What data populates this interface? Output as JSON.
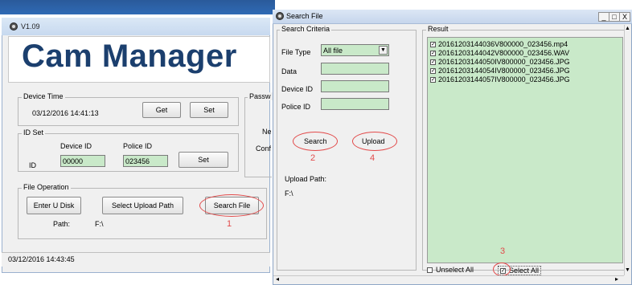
{
  "left": {
    "window_title": "V1.09",
    "banner": "Cam Manager",
    "device_time": {
      "legend": "Device Time",
      "value": "03/12/2016 14:41:13",
      "get_label": "Get",
      "set_label": "Set"
    },
    "password_legend": "Passw",
    "side_labels": [
      "Ne",
      "Conf"
    ],
    "id_set": {
      "legend": "ID Set",
      "device_id_label": "Device ID",
      "police_id_label": "Police ID",
      "id_label": "ID",
      "device_id_value": "00000",
      "police_id_value": "023456",
      "set_label": "Set"
    },
    "file_operation": {
      "legend": "File Operation",
      "enter_u_disk": "Enter U Disk",
      "select_upload_path": "Select Upload Path",
      "search_file": "Search File",
      "path_label": "Path:",
      "path_value": "F:\\",
      "annotation": "1"
    },
    "status_time": "03/12/2016 14:43:45"
  },
  "right": {
    "window_title": "Search File",
    "window_buttons": [
      "_",
      "□",
      "X"
    ],
    "criteria": {
      "legend": "Search Criteria",
      "file_type_label": "File Type",
      "file_type_value": "All file",
      "data_label": "Data",
      "device_id_label": "Device ID",
      "police_id_label": "Police ID",
      "search_label": "Search",
      "upload_label": "Upload",
      "annotation_search": "2",
      "annotation_upload": "4",
      "upload_path_label": "Upload Path:",
      "upload_path_value": "F:\\"
    },
    "result": {
      "legend": "Result",
      "files": [
        "20161203144036V800000_023456.mp4",
        "20161203144042V800000_023456.WAV",
        "20161203144050IV800000_023456.JPG",
        "20161203144054IV800000_023456.JPG",
        "20161203144057IV800000_023456.JPG"
      ],
      "unselect_all_label": "Unselect All",
      "select_all_label": "Select All",
      "annotation": "3"
    }
  }
}
